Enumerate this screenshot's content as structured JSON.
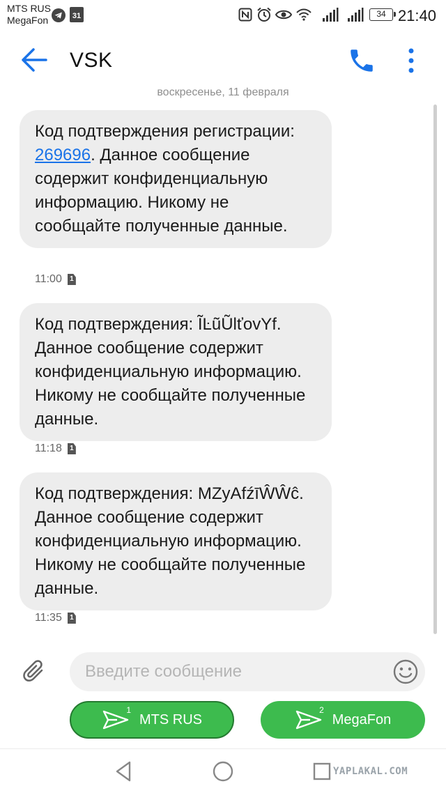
{
  "status_bar": {
    "carrier_1": "MTS RUS",
    "carrier_2": "MegaFon",
    "calendar_day": "31",
    "battery": "34",
    "time": "21:40"
  },
  "app_bar": {
    "title": "VSK"
  },
  "conversation": {
    "date_separator": "воскресенье, 11 февраля",
    "messages": [
      {
        "text_before": "Код подтверждения регистрации: ",
        "code": "269696",
        "text_after": ". Данное сообщение содержит конфиденциальную информацию. Никому не сообщайте полученные данные.",
        "time": "11:00",
        "sim": "1"
      },
      {
        "text": "Код подтверждения: ĨĿũŨlťovYf. Данное сообщение содержит конфиденциальную информацию. Никому не сообщайте полученные данные.",
        "time": "11:18",
        "sim": "1"
      },
      {
        "text": "Код подтверждения: MZyAfźīŴŴĉ. Данное сообщение содержит конфиденциальную информацию. Никому не сообщайте полученные данные.",
        "time": "11:35",
        "sim": "1"
      }
    ]
  },
  "composer": {
    "placeholder": "Введите сообщение",
    "send_sim1_label": "MTS RUS",
    "send_sim1_number": "1",
    "send_sim2_label": "MegaFon",
    "send_sim2_number": "2"
  },
  "watermark": "YAPLAKAL.COM",
  "colors": {
    "accent_blue": "#1a73e8",
    "send_green": "#3dbb4e",
    "bubble_grey": "#ededed"
  },
  "icons": {
    "status": [
      "telegram-icon",
      "calendar-icon",
      "nfc-icon",
      "alarm-icon",
      "eye-icon",
      "wifi-icon",
      "signal-icon",
      "battery-icon"
    ],
    "app_bar": [
      "back-arrow-icon",
      "phone-icon",
      "more-vert-icon"
    ],
    "composer": [
      "paperclip-icon",
      "emoji-icon",
      "send-icon"
    ],
    "nav": [
      "nav-back-icon",
      "nav-home-icon",
      "nav-recents-icon"
    ]
  }
}
